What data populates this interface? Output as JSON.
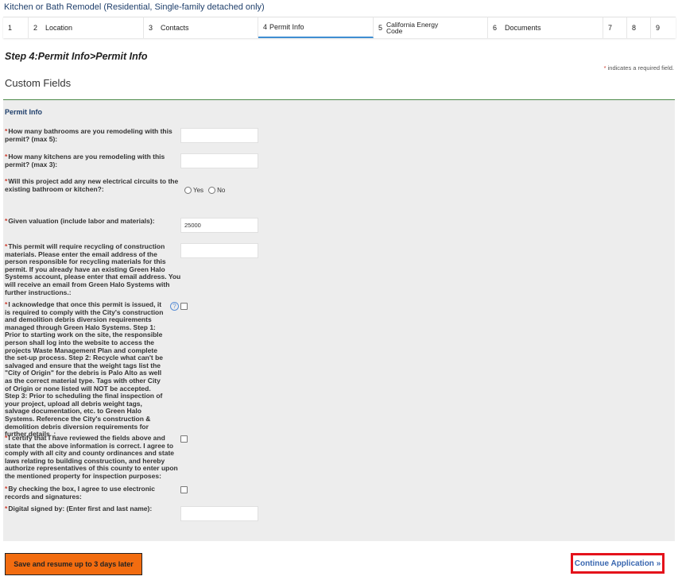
{
  "page_title": "Kitchen or Bath Remodel (Residential, Single-family detached only)",
  "steps": [
    {
      "num": "1",
      "label": ""
    },
    {
      "num": "2",
      "label": "Location"
    },
    {
      "num": "3",
      "label": "Contacts"
    },
    {
      "num": "4",
      "label": "Permit Info"
    },
    {
      "num": "5",
      "label_line1": "California Energy",
      "label_line2": "Code"
    },
    {
      "num": "6",
      "label": "Documents"
    },
    {
      "num": "7",
      "label": ""
    },
    {
      "num": "8",
      "label": ""
    },
    {
      "num": "9",
      "label": ""
    }
  ],
  "step_heading": "Step 4:Permit Info>Permit Info",
  "required_note": {
    "star": "*",
    "text": " indicates a required field."
  },
  "custom_fields_title": "Custom Fields",
  "section_title": "Permit Info",
  "fields": {
    "bathrooms": {
      "label": "How many bathrooms are you remodeling with this permit? (max 5):",
      "value": ""
    },
    "kitchens": {
      "label": "How many kitchens are you remodeling with this permit? (max 3):",
      "value": ""
    },
    "circuits": {
      "label": "Will this project add any new electrical circuits to the existing bathroom or kitchen?:",
      "yes": "Yes",
      "no": "No"
    },
    "valuation": {
      "label": "Given valuation (include labor and materials):",
      "value": "25000"
    },
    "recycling_email": {
      "label": "This permit will require recycling of construction materials. Please enter the email address of the person responsible for recycling materials for this permit. If you already have an existing Green Halo Systems account, please enter that email address. You will receive an email from Green Halo Systems with further instructions.:",
      "value": ""
    },
    "acknowledge": {
      "label": "I acknowledge that once this permit is issued, it is required to comply with the City's construction and demolition debris diversion requirements managed through Green Halo Systems. Step 1: Prior to starting work on the site, the responsible person shall log into the website to access the projects Waste Management Plan and complete the set-up process. Step 2: Recycle what can't be salvaged and ensure that the weight tags list the \"City of Origin\" for the debris is Palo Alto as well as the correct material type. Tags with other City of Origin or none listed will NOT be accepted. Step 3: Prior to scheduling the final inspection of your project, upload all debris weight tags, salvage documentation, etc. to Green Halo Systems. Reference the City's construction & demolition debris diversion requirements for further details. :",
      "help": "?"
    },
    "certify": {
      "label": "I certify that I have reviewed the fields above and state that the above information is correct. I agree to comply with all city and county ordinances and state laws relating to building construction, and hereby authorize representatives of this county to enter upon the mentioned property for inspection purposes:"
    },
    "electronic": {
      "label": "By checking the box, I agree to use electronic records and signatures:"
    },
    "signed_by": {
      "label": "Digital signed by: (Enter first and last name):",
      "value": ""
    }
  },
  "star": "*",
  "buttons": {
    "save": "Save and resume up to 3 days later",
    "continue": "Continue Application »"
  },
  "colors": {
    "accent_blue": "#3f8ed1",
    "save_orange": "#f26c10",
    "continue_border": "#e4121b",
    "required_red": "#cc3b2c"
  }
}
